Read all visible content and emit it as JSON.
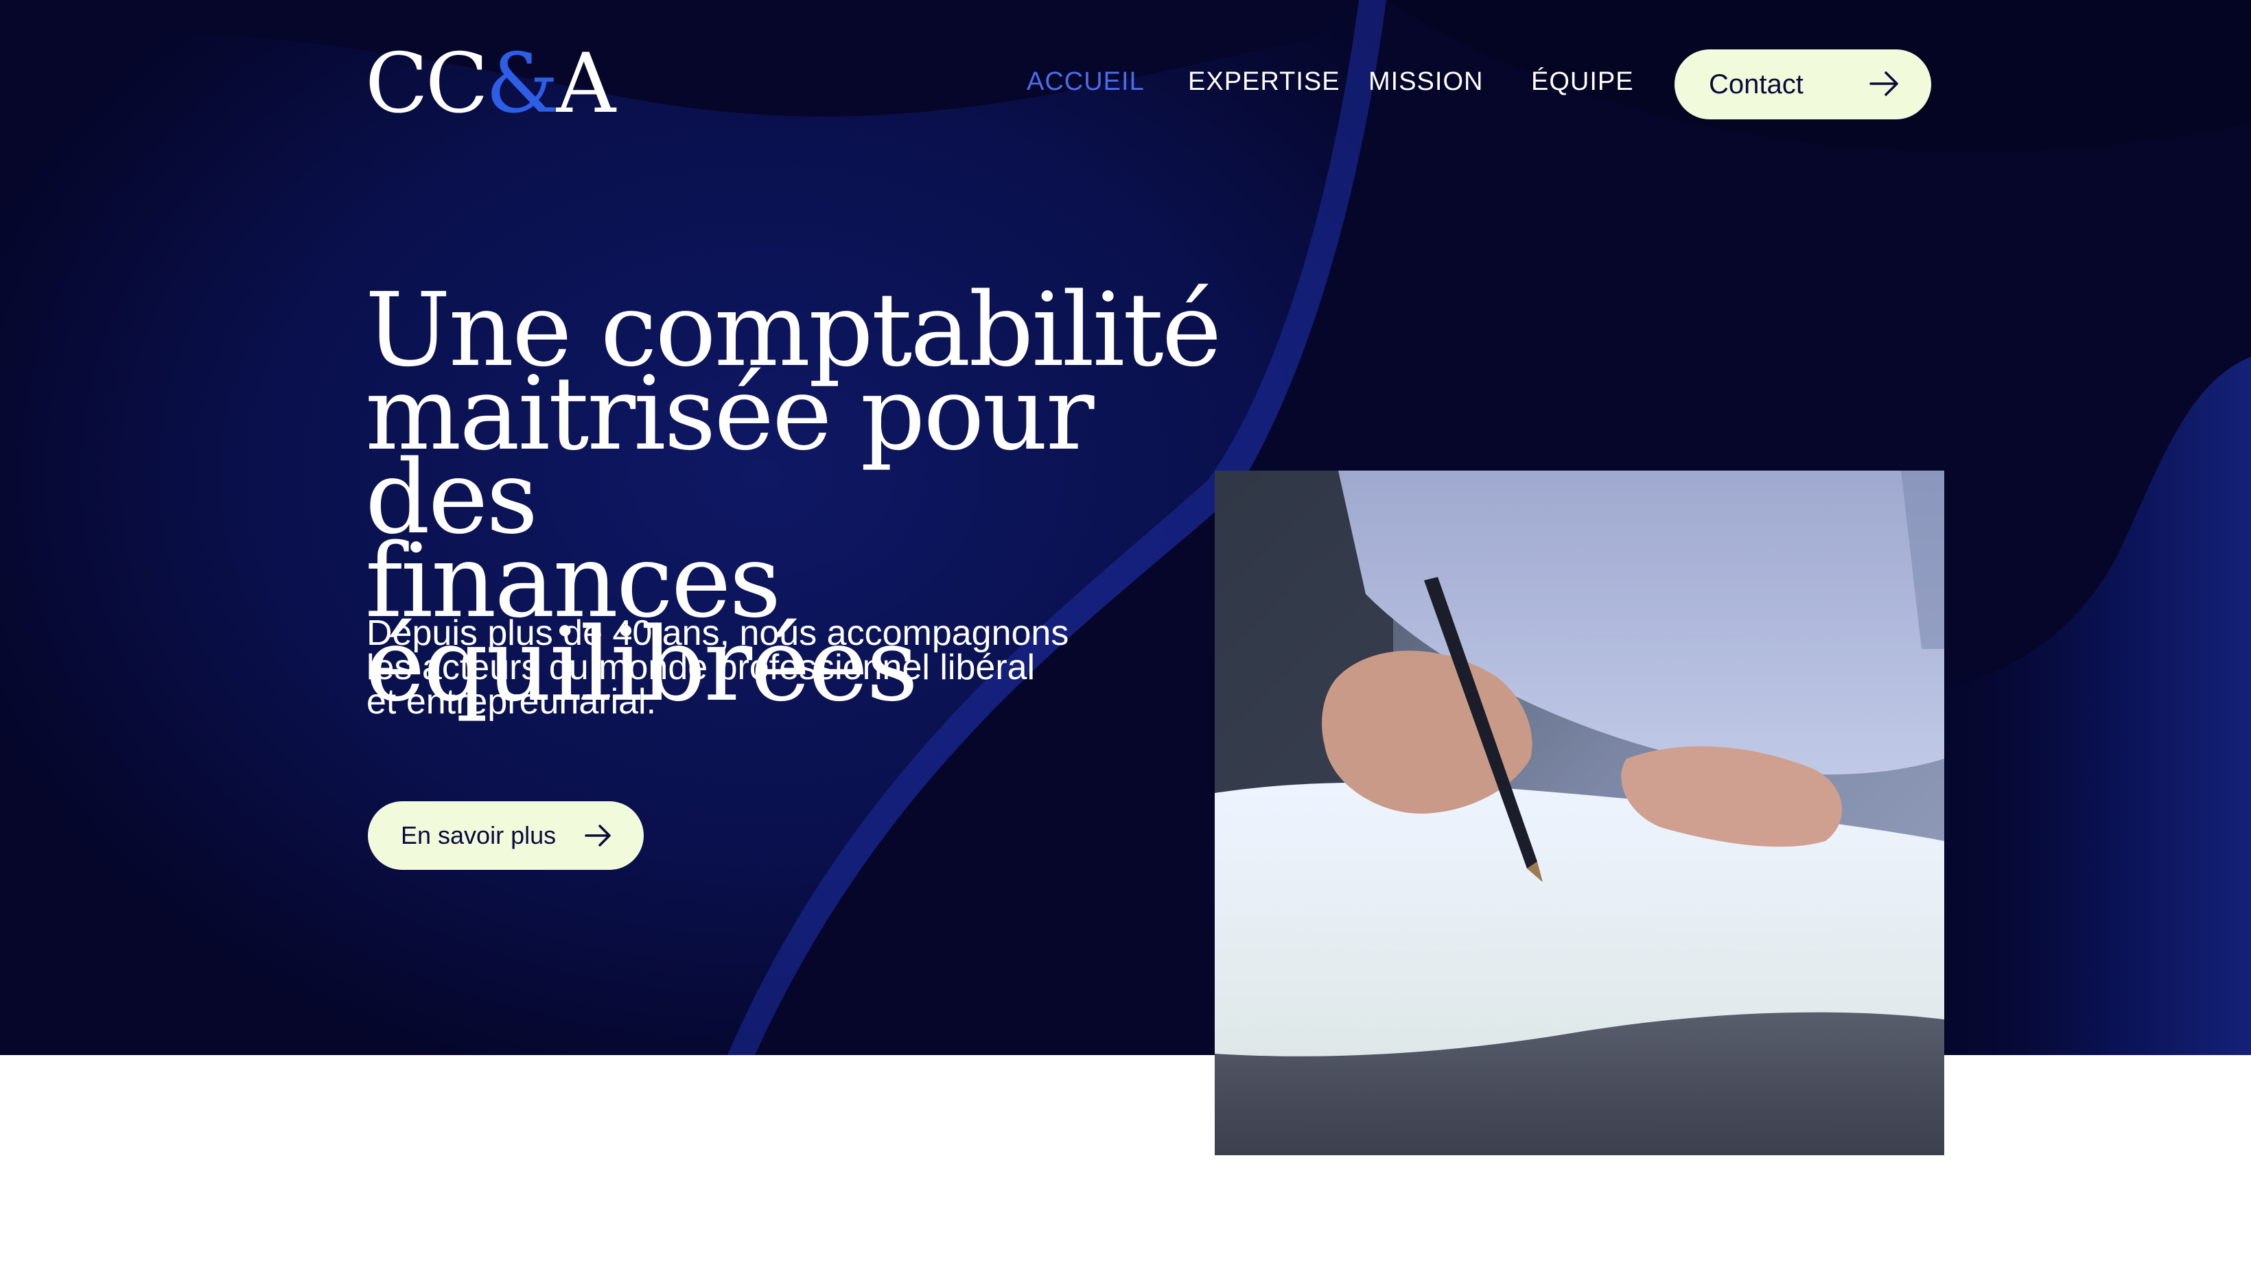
{
  "brand": {
    "logo_left": "CC",
    "logo_amp": "&",
    "logo_right": "A"
  },
  "nav": {
    "items": [
      {
        "label": "ACCUEIL",
        "active": true
      },
      {
        "label": "EXPERTISE",
        "active": false
      },
      {
        "label": "MISSION",
        "active": false
      },
      {
        "label": "ÉQUIPE",
        "active": false
      }
    ],
    "contact_label": "Contact"
  },
  "hero": {
    "headline_line1": "Une comptabilité",
    "headline_line2": "maitrisée pour des",
    "headline_line3": "finances équilibrées",
    "subtitle_line1": "Depuis plus de 40 ans, nous accompagnons",
    "subtitle_line2": "les acteurs du monde professionnel libéral",
    "subtitle_line3": "et entrepreunarial.",
    "cta_label": "En savoir plus"
  },
  "icons": {
    "arrow": "arrow-right-icon"
  },
  "colors": {
    "background": "#05062a",
    "accent_blue": "#2f5ee6",
    "nav_active": "#4d6ce8",
    "button_bg": "#f1fbdb",
    "button_text": "#0a0b3a"
  }
}
